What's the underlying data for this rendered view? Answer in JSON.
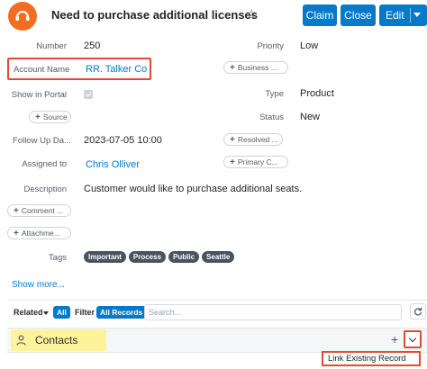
{
  "header": {
    "title": "Need to purchase additional licenses",
    "icon": "case-icon",
    "buttons": {
      "claim": "Claim",
      "close": "Close",
      "edit": "Edit"
    }
  },
  "fields": {
    "number": {
      "label": "Number",
      "value": "250"
    },
    "priority": {
      "label": "Priority",
      "value": "Low"
    },
    "account_name": {
      "label": "Account Name",
      "value": "RR. Talker Co"
    },
    "business_pill": "Business ...",
    "show_in_portal": {
      "label": "Show in Portal",
      "checked": true
    },
    "type": {
      "label": "Type",
      "value": "Product"
    },
    "source_pill": "Source",
    "status": {
      "label": "Status",
      "value": "New"
    },
    "follow_up": {
      "label": "Follow Up Da...",
      "value": "2023-07-05 10:00"
    },
    "resolved_pill": "Resolved ...",
    "assigned_to": {
      "label": "Assigned to",
      "value": "Chris Olliver"
    },
    "primary_pill": "Primary C...",
    "description": {
      "label": "Description",
      "value": "Customer would like to purchase additional seats."
    },
    "comment_pill": "Comment ...",
    "attachment_pill": "Attachme...",
    "tags": {
      "label": "Tags",
      "items": [
        "Important",
        "Process",
        "Public",
        "Seattle"
      ]
    }
  },
  "show_more": "Show more...",
  "related_bar": {
    "related_label": "Related",
    "all_chip": "All",
    "filter_label": "Filter",
    "all_records_chip": "All Records",
    "search_placeholder": "Search..."
  },
  "contacts": {
    "label": "Contacts"
  },
  "menu": {
    "link_existing": "Link Existing Record"
  },
  "colors": {
    "accent": "#0679c8",
    "case_icon": "#f36c21",
    "highlight": "#fdf39b",
    "annotation": "#e34a36",
    "tag_bg": "#4b5260"
  }
}
